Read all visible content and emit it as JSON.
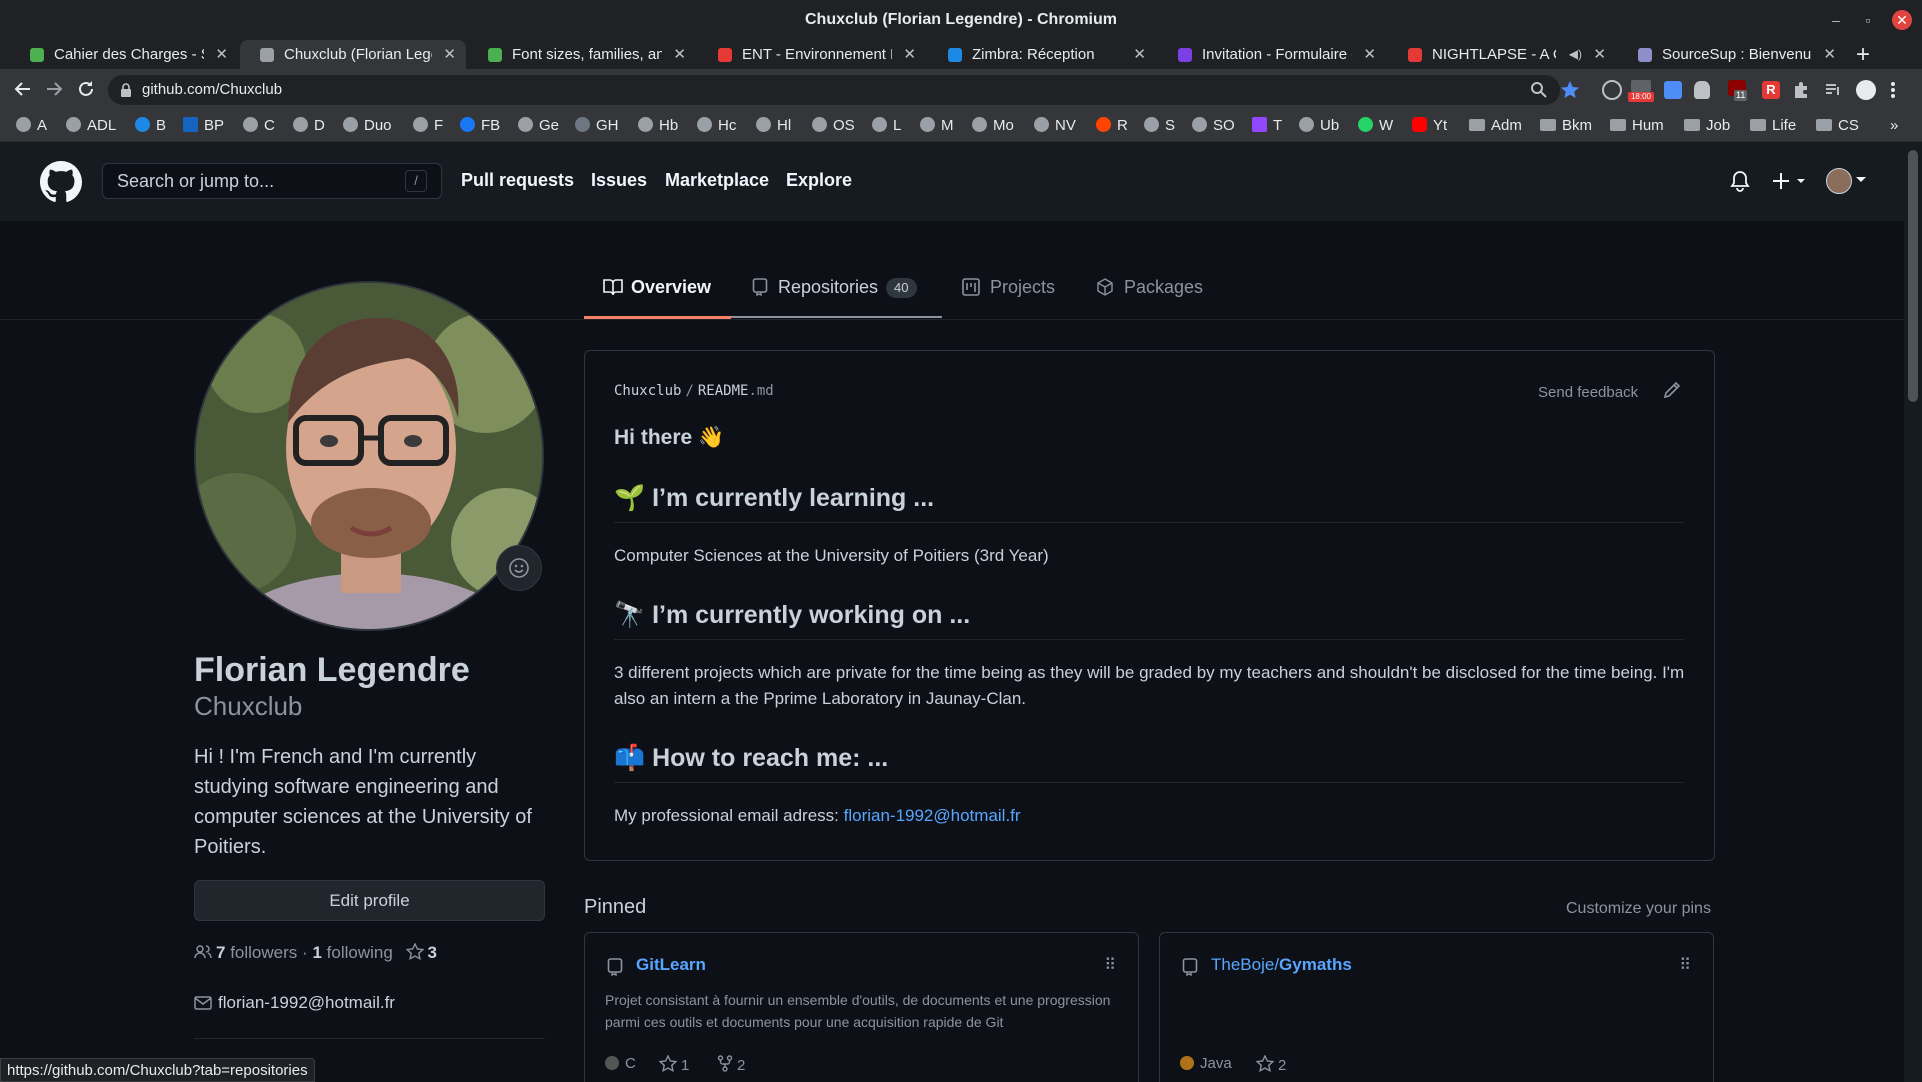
{
  "window": {
    "title": "Chuxclub (Florian Legendre) - Chromium",
    "minimize": "–",
    "maximize": "▫",
    "close": "✕"
  },
  "tabs": [
    {
      "label": "Cahier des Charges - Sta",
      "icon": "overleaf-icon",
      "color": "#4caf50"
    },
    {
      "label": "Chuxclub (Florian Legen",
      "icon": "github-icon",
      "color": "#9aa0a6"
    },
    {
      "label": "Font sizes, families, and",
      "icon": "overleaf-icon",
      "color": "#4caf50"
    },
    {
      "label": "ENT - Environnement Nu",
      "icon": "ent-icon",
      "color": "#e53935"
    },
    {
      "label": "Zimbra: Réception",
      "icon": "zimbra-icon",
      "color": "#1e88e5"
    },
    {
      "label": "Invitation - Formulaire d",
      "icon": "forms-icon",
      "color": "#7b3fe4"
    },
    {
      "label": "NIGHTLAPSE - A Chill",
      "icon": "youtube-icon",
      "color": "#e53935"
    },
    {
      "label": "SourceSup : Bienvenue",
      "icon": "sourcesup-icon",
      "color": "#8e8ec8"
    }
  ],
  "new_tab": "+",
  "tab_close": "✕",
  "audio_icon": "◀)",
  "address": {
    "url": "github.com/Chuxclub"
  },
  "bookmarks": [
    {
      "label": "A",
      "type": "site"
    },
    {
      "label": "ADL",
      "type": "site"
    },
    {
      "label": "B",
      "type": "site"
    },
    {
      "label": "BP",
      "type": "site"
    },
    {
      "label": "C",
      "type": "site"
    },
    {
      "label": "D",
      "type": "site"
    },
    {
      "label": "Duo",
      "type": "site"
    },
    {
      "label": "F",
      "type": "site"
    },
    {
      "label": "FB",
      "type": "site"
    },
    {
      "label": "Ge",
      "type": "site"
    },
    {
      "label": "GH",
      "type": "site"
    },
    {
      "label": "Hb",
      "type": "site"
    },
    {
      "label": "Hc",
      "type": "site"
    },
    {
      "label": "Hl",
      "type": "site"
    },
    {
      "label": "OS",
      "type": "site"
    },
    {
      "label": "L",
      "type": "site"
    },
    {
      "label": "M",
      "type": "site"
    },
    {
      "label": "Mo",
      "type": "site"
    },
    {
      "label": "NV",
      "type": "site"
    },
    {
      "label": "R",
      "type": "site"
    },
    {
      "label": "S",
      "type": "site"
    },
    {
      "label": "SO",
      "type": "site"
    },
    {
      "label": "T",
      "type": "site"
    },
    {
      "label": "Ub",
      "type": "site"
    },
    {
      "label": "W",
      "type": "site"
    },
    {
      "label": "Yt",
      "type": "site"
    },
    {
      "label": "Adm",
      "type": "folder"
    },
    {
      "label": "Bkm",
      "type": "folder"
    },
    {
      "label": "Hum",
      "type": "folder"
    },
    {
      "label": "Job",
      "type": "folder"
    },
    {
      "label": "Life",
      "type": "folder"
    },
    {
      "label": "CS",
      "type": "folder"
    }
  ],
  "bookmarks_more": "»",
  "extension_badge": "18:00",
  "extension_badge2": "11",
  "github": {
    "search_placeholder": "Search or jump to...",
    "search_key": "/",
    "nav": [
      "Pull requests",
      "Issues",
      "Marketplace",
      "Explore"
    ]
  },
  "profile_tabs": [
    {
      "label": "Overview",
      "icon": "book-icon"
    },
    {
      "label": "Repositories",
      "icon": "repo-icon",
      "count": "40"
    },
    {
      "label": "Projects",
      "icon": "project-icon"
    },
    {
      "label": "Packages",
      "icon": "package-icon"
    }
  ],
  "profile": {
    "name": "Florian Legendre",
    "login": "Chuxclub",
    "bio": "Hi ! I'm French and I'm currently studying software engineering and computer sciences at the University of Poitiers.",
    "edit_button": "Edit profile",
    "followers": "7",
    "followers_label": "followers",
    "separator": "·",
    "following": "1",
    "following_label": "following",
    "stars": "3",
    "email": "florian-1992@hotmail.fr"
  },
  "readme": {
    "owner": "Chuxclub",
    "slash": "/",
    "file": "README",
    "ext": ".md",
    "send_feedback": "Send feedback",
    "greeting": "Hi there 👋",
    "h_learning": "🌱 I’m currently learning ...",
    "p_learning": "Computer Sciences at the University of Poitiers (3rd Year)",
    "h_working": "🔭 I’m currently working on ...",
    "p_working": "3 different projects which are private for the time being as they will be graded by my teachers and shouldn't be disclosed for the time being. I'm also an intern a the Pprime Laboratory in Jaunay-Clan.",
    "h_reach": "📫 How to reach me: ...",
    "p_reach_label": "My professional email adress:",
    "p_reach_email": "florian-1992@hotmail.fr"
  },
  "pinned": {
    "title": "Pinned",
    "customize": "Customize your pins",
    "repos": [
      {
        "owner": "",
        "name": "GitLearn",
        "description": "Projet consistant à fournir un ensemble d'outils, de documents et une progression parmi ces outils et documents pour une acquisition rapide de Git",
        "language": "C",
        "lang_color": "#555555",
        "stars": "1",
        "forks": "2"
      },
      {
        "owner": "TheBoje/",
        "name": "Gymaths",
        "description": "",
        "language": "Java",
        "lang_color": "#b07219",
        "stars": "2",
        "forks": ""
      }
    ]
  },
  "status_url": "https://github.com/Chuxclub?tab=repositories"
}
